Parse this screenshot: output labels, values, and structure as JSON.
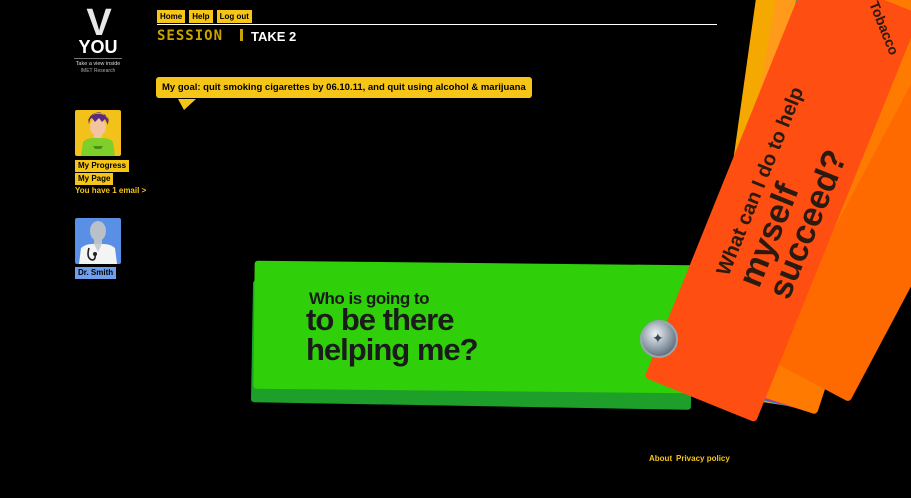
{
  "logo": {
    "letter": "V",
    "word": "YOU",
    "tagline": "Take a view inside",
    "org": "IMET Research"
  },
  "sidebar": {
    "progress_label": "My Progress",
    "page_label": "My Page",
    "email_note": "You have 1 email >",
    "doctor_label": "Dr. Smith"
  },
  "topnav": {
    "home": "Home",
    "help": "Help",
    "logout": "Log out"
  },
  "session": {
    "title": "SESSION",
    "take": "TAKE 2"
  },
  "goal": {
    "text": "My goal: quit smoking cigarettes by 06.10.11, and quit using alcohol & marijuana"
  },
  "card": {
    "question_line1": "Who is going to",
    "question_line2": "to be there",
    "question_line3": "helping me?"
  },
  "fan": {
    "main_small": "What can I do to help",
    "main_big_1": "myself",
    "main_big_2": "succeed?",
    "side_label": "Tobacco"
  },
  "footer": {
    "about": "About",
    "privacy": "Privacy policy"
  },
  "colors": {
    "accent_yellow": "#f5c518",
    "card_green": "#2fcf0a",
    "card_orange": "#ff4e12",
    "doctor_blue": "#5a8fe6"
  }
}
